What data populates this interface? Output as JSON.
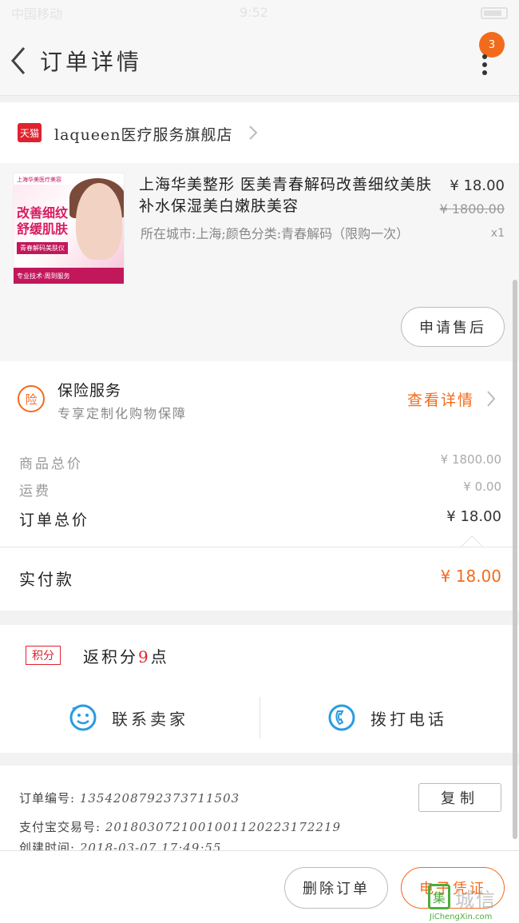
{
  "status_bar": {
    "carrier": "中国移动",
    "time": "9:52"
  },
  "header": {
    "title": "订单详情",
    "notification_count": "3"
  },
  "store": {
    "logo_text": "天猫",
    "name": "laqueen医疗服务旗舰店"
  },
  "product": {
    "image": {
      "brand_line": "上海华美医疗美容",
      "headline": "改善细纹 舒缓肌肤",
      "tag": "青春解码美肤仪",
      "footer": "专业技术·周到服务"
    },
    "title": "上海华美整形 医美青春解码改善细纹美肤补水保湿美白嫩肤美容",
    "attributes": "所在城市:上海;颜色分类:青春解码（限购一次）",
    "price": "¥ 18.00",
    "original_price": "¥ 1800.00",
    "quantity": "x1",
    "after_sale_label": "申请售后"
  },
  "insurance": {
    "icon_text": "险",
    "title": "保险服务",
    "subtitle": "专享定制化购物保障",
    "link_label": "查看详情"
  },
  "summary": {
    "goods_total_label": "商品总价",
    "goods_total_value": "¥ 1800.00",
    "shipping_label": "运费",
    "shipping_value": "¥ 0.00",
    "order_total_label": "订单总价",
    "order_total_value": "¥ 18.00"
  },
  "payment": {
    "paid_label": "实付款",
    "paid_value": "¥ 18.00"
  },
  "points": {
    "badge": "积分",
    "text_prefix": "返积分",
    "amount": "9",
    "text_suffix": "点"
  },
  "actions": {
    "contact_seller": "联系卖家",
    "call_phone": "拨打电话"
  },
  "order_info": {
    "order_no_label": "订单编号:",
    "order_no": "1354208792373711503",
    "alipay_label": "支付宝交易号:",
    "alipay_no": "2018030721001001120223172219",
    "created_label": "创建时间:",
    "created_time": "2018-03-07 17:49:55",
    "copy_label": "复制"
  },
  "bottom_bar": {
    "delete_label": "删除订单",
    "invoice_label": "电子凭证"
  },
  "watermark": {
    "box": "集",
    "cn": "城信",
    "en": "JiChengXin.com"
  },
  "colors": {
    "accent": "#f26b1d",
    "tmall_red": "#e0222e",
    "background": "#f2f2f2"
  }
}
